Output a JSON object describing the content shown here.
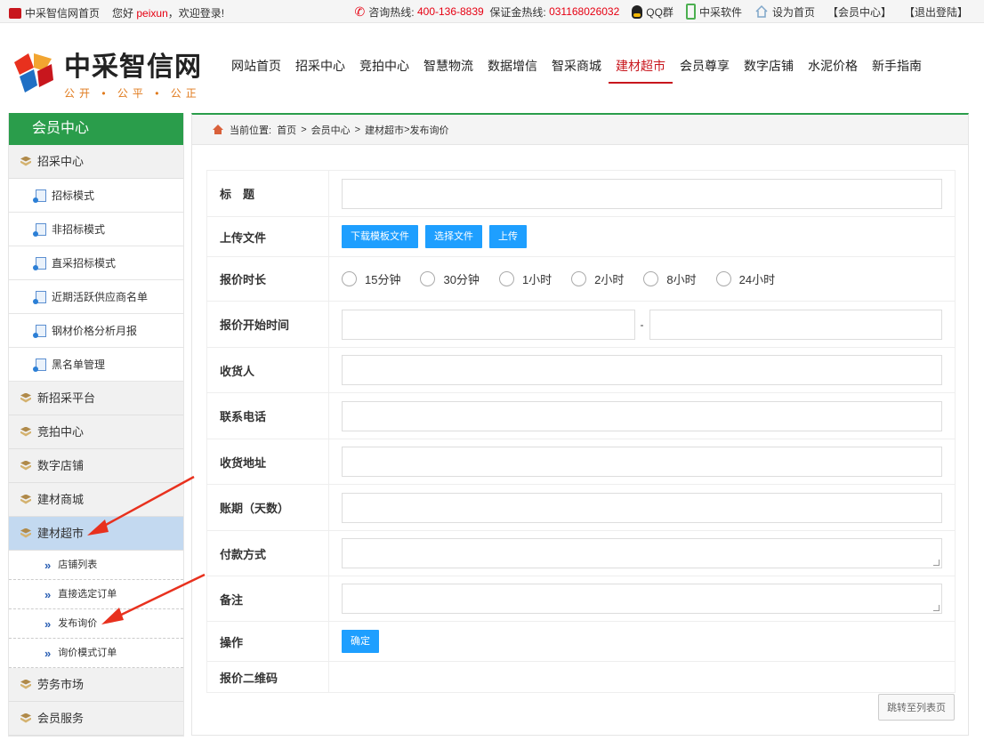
{
  "topbar": {
    "home_link": "中采智信网首页",
    "greeting_prefix": "您好",
    "username": "peixun",
    "greeting_suffix": "，欢迎登录!",
    "hotline_label": "咨询热线:",
    "hotline": "400-136-8839",
    "deposit_label": "保证金热线:",
    "deposit": "031168026032",
    "qq": "QQ群",
    "software": "中采软件",
    "set_home": "设为首页",
    "member_center": "【会员中心】",
    "logout": "【退出登陆】"
  },
  "logo": {
    "name": "中采智信网",
    "slogan": "公开 • 公平 • 公正"
  },
  "nav": [
    {
      "label": "网站首页"
    },
    {
      "label": "招采中心"
    },
    {
      "label": "竞拍中心"
    },
    {
      "label": "智慧物流"
    },
    {
      "label": "数据增信"
    },
    {
      "label": "智采商城"
    },
    {
      "label": "建材超市",
      "active": true
    },
    {
      "label": "会员尊享"
    },
    {
      "label": "数字店铺"
    },
    {
      "label": "水泥价格"
    },
    {
      "label": "新手指南"
    }
  ],
  "sidebar": {
    "title": "会员中心",
    "group_zhaocai": "招采中心",
    "zhaocai_items": [
      "招标模式",
      "非招标模式",
      "直采招标模式",
      "近期活跃供应商名单",
      "钢材价格分析月报",
      "黑名单管理"
    ],
    "group_xinzhaocai": "新招采平台",
    "group_jingpai": "竞拍中心",
    "group_shuzi": "数字店铺",
    "group_jiancai_shangcheng": "建材商城",
    "group_jiancai_chaoshi": "建材超市",
    "chaoshi_items": [
      "店铺列表",
      "直接选定订单",
      "发布询价",
      "询价模式订单"
    ],
    "group_laowu": "劳务市场",
    "group_huiyuan": "会员服务"
  },
  "breadcrumb": {
    "label": "当前位置:",
    "items": [
      "首页",
      "会员中心",
      "建材超市",
      "发布询价"
    ],
    "sep": ">"
  },
  "form": {
    "title_label": "标　题",
    "upload_label": "上传文件",
    "btn_download": "下载模板文件",
    "btn_choose": "选择文件",
    "btn_upload": "上传",
    "duration_label": "报价时长",
    "durations": [
      "15分钟",
      "30分钟",
      "1小时",
      "2小时",
      "8小时",
      "24小时"
    ],
    "start_label": "报价开始时间",
    "range_sep": "-",
    "receiver_label": "收货人",
    "phone_label": "联系电话",
    "address_label": "收货地址",
    "term_label": "账期（天数）",
    "payment_label": "付款方式",
    "remark_label": "备注",
    "action_label": "操作",
    "btn_confirm": "确定",
    "qrcode_label": "报价二维码"
  },
  "jump_button": "跳转至列表页",
  "colors": {
    "brand_red": "#c8161d",
    "brand_green": "#2a9d4b",
    "button_blue": "#1e9fff",
    "highlight": "#c3d9f0",
    "arrow_red": "#e8311e"
  }
}
